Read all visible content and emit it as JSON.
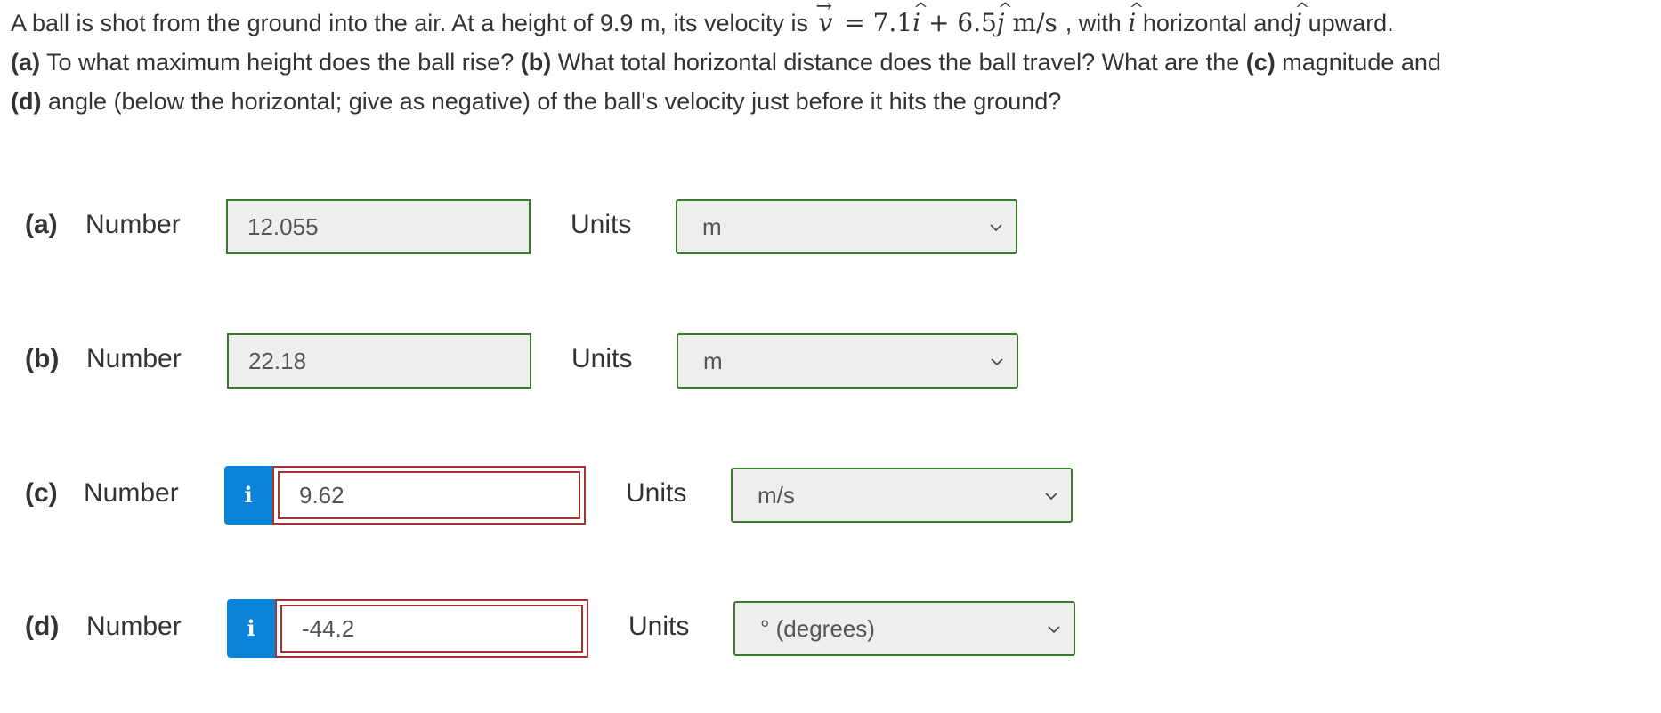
{
  "question": {
    "lead": "A ball is shot from the ground into the air. At a height of 9.9 m, its velocity is",
    "vector_symbol": "v",
    "arrow": "→",
    "equals": "=",
    "coef_i": "7.1",
    "plus": "+",
    "coef_j": "6.5",
    "i_symbol": "i",
    "j_symbol": "j",
    "hat": "^",
    "velocity_unit": "m/s",
    "comma_with": ", with",
    "horizontal_and": "horizontal and",
    "upward": "upward.",
    "a_label": "(a)",
    "a_text": "To what maximum height does the ball rise?",
    "b_label": "(b)",
    "b_text": "What total horizontal distance does the ball travel? What are the",
    "c_label": "(c)",
    "c_text": "magnitude and",
    "d_label": "(d)",
    "d_text": "angle (below the horizontal; give as negative) of the ball's velocity just before it hits the ground?"
  },
  "rows": [
    {
      "part": "(a)",
      "number_label": "Number",
      "value": "12.055",
      "units_label": "Units",
      "unit": "m",
      "status": "correct"
    },
    {
      "part": "(b)",
      "number_label": "Number",
      "value": "22.18",
      "units_label": "Units",
      "unit": "m",
      "status": "correct"
    },
    {
      "part": "(c)",
      "number_label": "Number",
      "info": "i",
      "value": "9.62",
      "units_label": "Units",
      "unit": "m/s",
      "status": "incorrect"
    },
    {
      "part": "(d)",
      "number_label": "Number",
      "info": "i",
      "value": "-44.2",
      "units_label": "Units",
      "unit": "° (degrees)",
      "status": "incorrect"
    }
  ],
  "colors": {
    "correct_border": "#3a7a2e",
    "incorrect_border": "#a83232",
    "info_button": "#0a84d8"
  },
  "icons": {
    "dropdown": "chevron-down-icon",
    "info": "info-icon"
  }
}
